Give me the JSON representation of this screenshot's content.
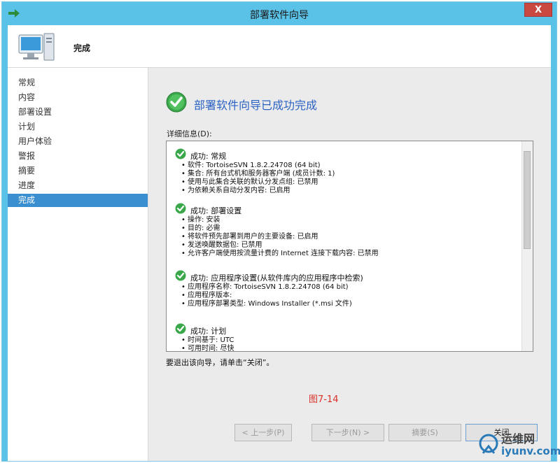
{
  "window": {
    "title": "部署软件向导",
    "close_label": "X"
  },
  "header": {
    "title": "完成"
  },
  "nav": {
    "items": [
      "常规",
      "内容",
      "部署设置",
      "计划",
      "用户体验",
      "警报",
      "摘要",
      "进度",
      "完成"
    ],
    "active_index": 8
  },
  "main": {
    "success_title": "部署软件向导已成功完成",
    "details_label": "详细信息(D):",
    "sections": [
      {
        "heading": "成功: 常规",
        "items": [
          "软件: TortoiseSVN 1.8.2.24708 (64 bit)",
          "集合: 所有台式机和服务器客户端 (成员计数: 1)",
          "使用与此集合关联的默认分发点组: 已禁用",
          "为依赖关系自动分发内容: 已启用"
        ]
      },
      {
        "heading": "成功: 部署设置",
        "items": [
          "操作: 安装",
          "目的: 必需",
          "将软件预先部署到用户的主要设备: 已启用",
          "发送唤醒数据包: 已禁用",
          "允许客户端使用按流量计费的 Internet 连接下载内容: 已禁用"
        ]
      },
      {
        "heading": "成功: 应用程序设置(从软件库内的应用程序中检索)",
        "items": [
          "应用程序名称: TortoiseSVN 1.8.2.24708 (64 bit)",
          "应用程序版本:",
          "应用程序部署类型: Windows Installer (*.msi 文件)"
        ]
      },
      {
        "heading": "成功: 计划",
        "items": [
          "时间基于: UTC",
          "可用时间: 尽快"
        ]
      }
    ],
    "exit_text": "要退出该向导，请单击“关闭”。",
    "figure_caption": "图7-14"
  },
  "buttons": {
    "prev": "< 上一步(P)",
    "next": "下一步(N) >",
    "summary": "摘要(S)",
    "close": "关闭"
  },
  "watermark": {
    "line1": "运维网",
    "line2": "iyunv.com"
  },
  "colors": {
    "titlebar": "#5bc2e7",
    "nav_active": "#3a8fd0",
    "success_title": "#2b63c4",
    "caption": "#d9302a"
  }
}
